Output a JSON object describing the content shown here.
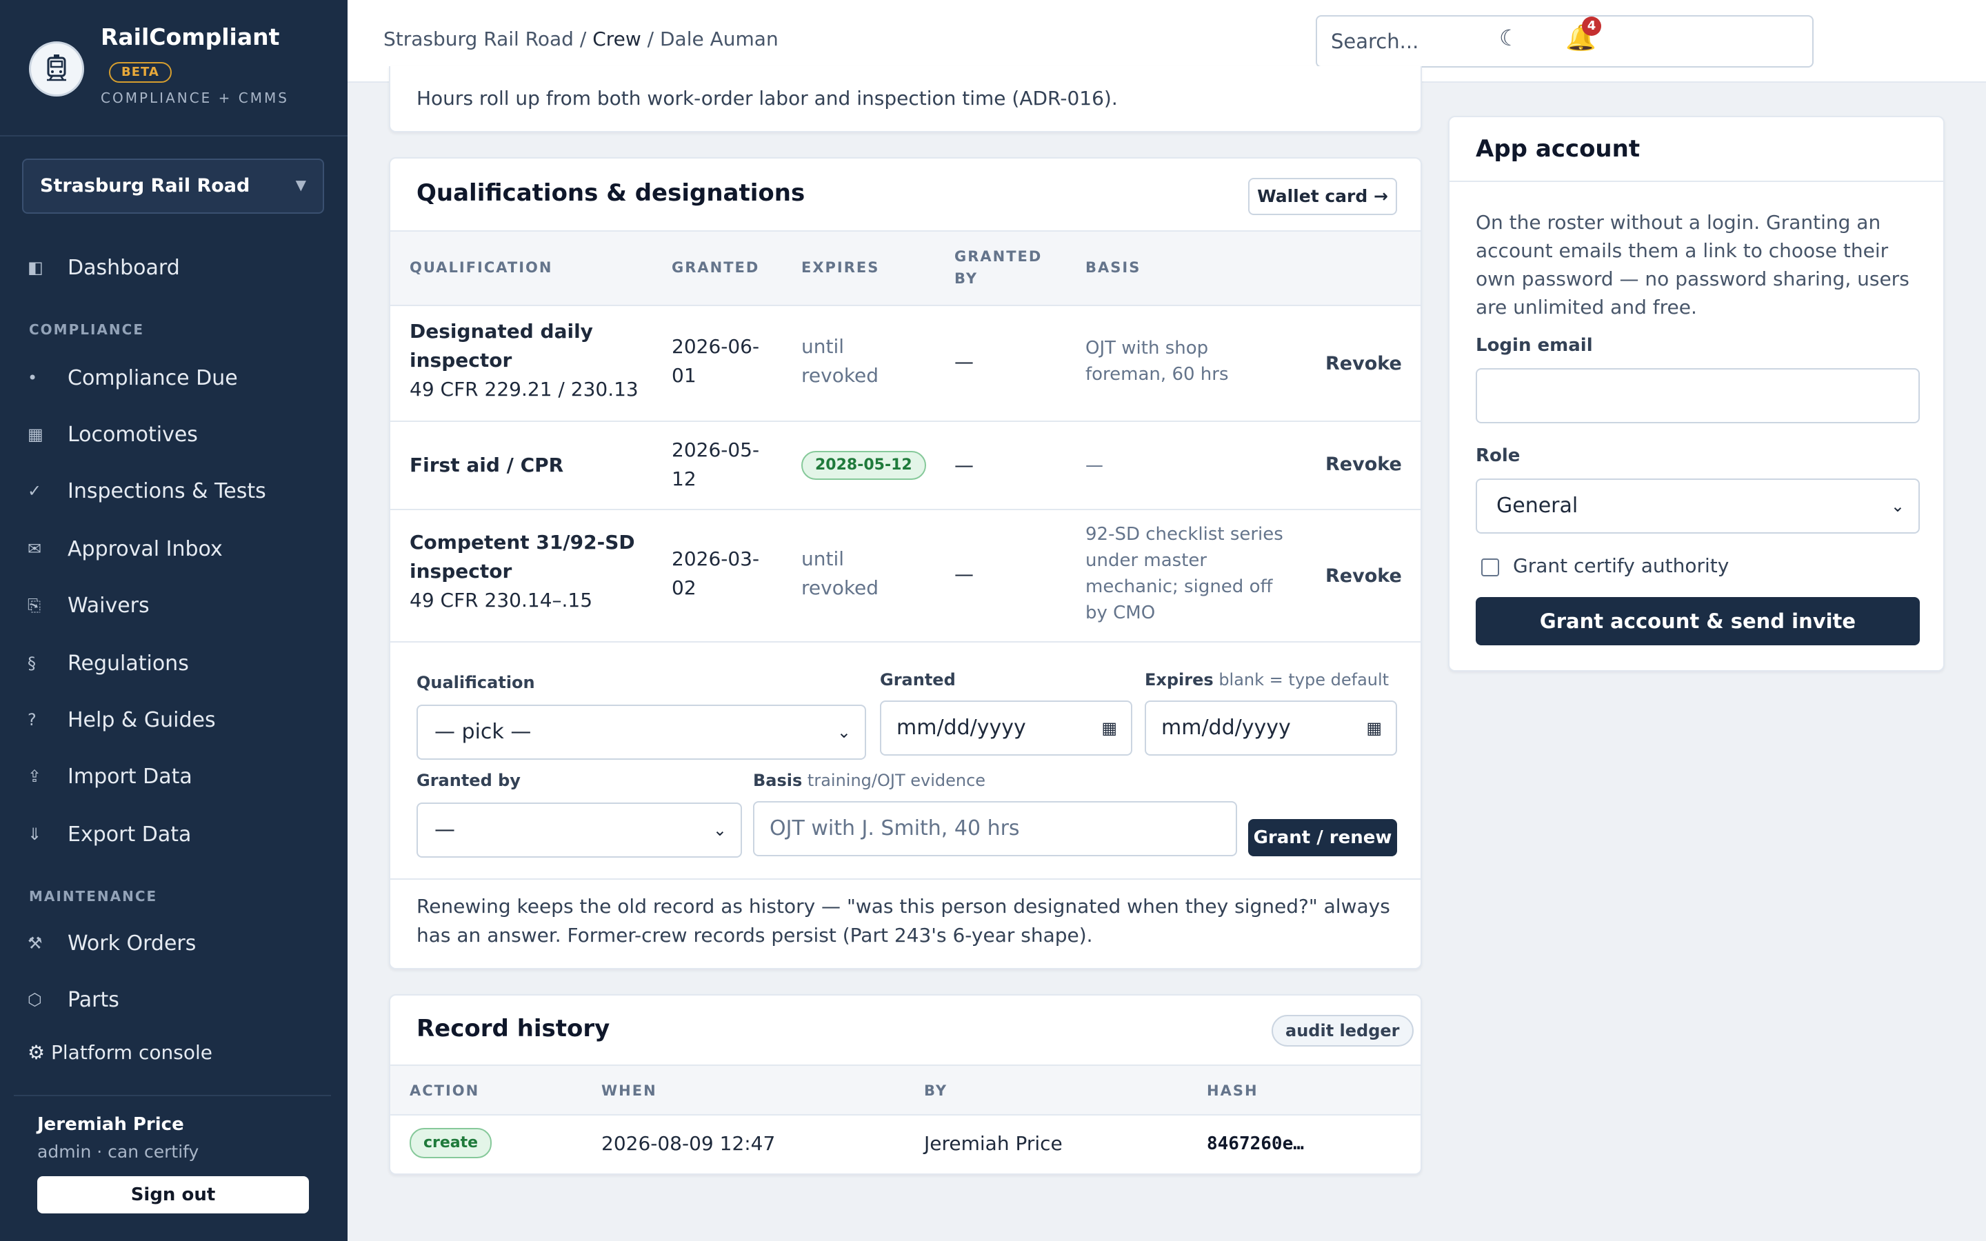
{
  "brand": {
    "name": "RailCompliant",
    "badge": "BETA",
    "subtitle": "COMPLIANCE + CMMS"
  },
  "org": {
    "selected": "Strasburg Rail Road"
  },
  "nav": {
    "dashboard": {
      "icon": "dashboard-icon",
      "label": "Dashboard"
    },
    "compliance_section": "COMPLIANCE",
    "compliance_items": [
      {
        "icon": "dot-icon",
        "label": "Compliance Due"
      },
      {
        "icon": "grid-icon",
        "label": "Locomotives"
      },
      {
        "icon": "check-icon",
        "label": "Inspections & Tests"
      },
      {
        "icon": "mail-icon",
        "label": "Approval Inbox"
      },
      {
        "icon": "waiver-icon",
        "label": "Waivers"
      },
      {
        "icon": "section-icon",
        "label": "Regulations"
      },
      {
        "icon": "help-icon",
        "label": "Help & Guides"
      },
      {
        "icon": "import-icon",
        "label": "Import Data"
      },
      {
        "icon": "export-icon",
        "label": "Export Data"
      }
    ],
    "maintenance_section": "MAINTENANCE",
    "maintenance_items": [
      {
        "icon": "wrench-icon",
        "label": "Work Orders"
      },
      {
        "icon": "hexagon-icon",
        "label": "Parts"
      }
    ],
    "platform_console": "⚙ Platform console"
  },
  "user": {
    "name": "Jeremiah Price",
    "role": "admin · can certify",
    "signout": "Sign out"
  },
  "topbar": {
    "breadcrumb": {
      "org": "Strasburg Rail Road",
      "sep1": " / ",
      "section": "Crew",
      "sep2": " / ",
      "person": "Dale Auman"
    },
    "search_placeholder": "Search...",
    "notifications": "4"
  },
  "hours_note": "Hours roll up from both work-order labor and inspection time (ADR-016).",
  "qualifications": {
    "title": "Qualifications & designations",
    "wallet_button": "Wallet card →",
    "columns": {
      "qualification": "QUALIFICATION",
      "granted": "GRANTED",
      "expires": "EXPIRES",
      "granted_by_1": "GRANTED",
      "granted_by_2": "BY",
      "basis": "BASIS"
    },
    "rows": [
      {
        "name_1": "Designated daily",
        "name_2": "inspector",
        "reg": "49 CFR 229.21 / 230.13",
        "granted_1": "2026-06-",
        "granted_2": "01",
        "expires_1": "until",
        "expires_2": "revoked",
        "granted_by": "—",
        "basis_1": "OJT with shop",
        "basis_2": "foreman, 60 hrs",
        "action": "Revoke"
      },
      {
        "name_1": "First aid / CPR",
        "granted_1": "2026-05-",
        "granted_2": "12",
        "expires_badge": "2028-05-12",
        "granted_by": "—",
        "basis_1": "—",
        "action": "Revoke"
      },
      {
        "name_1": "Competent 31/92-SD",
        "name_2": "inspector",
        "reg": "49 CFR 230.14–.15",
        "granted_1": "2026-03-",
        "granted_2": "02",
        "expires_1": "until",
        "expires_2": "revoked",
        "granted_by": "—",
        "basis_1": "92-SD checklist series",
        "basis_2": "under master",
        "basis_3": "mechanic; signed off",
        "basis_4": "by CMO",
        "action": "Revoke"
      }
    ],
    "form": {
      "qualification_label": "Qualification",
      "qualification_value": "— pick —",
      "granted_label": "Granted",
      "granted_placeholder": "mm/dd/yyyy",
      "expires_label": "Expires",
      "expires_hint": " blank = type default",
      "expires_placeholder": "mm/dd/yyyy",
      "granted_by_label": "Granted by",
      "granted_by_value": "—",
      "basis_label": "Basis",
      "basis_hint": " training/OJT evidence",
      "basis_placeholder": "OJT with J. Smith, 40 hrs",
      "submit": "Grant / renew"
    },
    "note": "Renewing keeps the old record as history — \"was this person designated when they signed?\" always has an answer. Former-crew records persist (Part 243's 6-year shape)."
  },
  "history": {
    "title": "Record history",
    "tag": "audit ledger",
    "columns": {
      "action": "ACTION",
      "when": "WHEN",
      "by": "BY",
      "hash": "HASH"
    },
    "rows": [
      {
        "action": "create",
        "when": "2026-08-09 12:47",
        "by": "Jeremiah Price",
        "hash": "8467260e…"
      }
    ]
  },
  "account": {
    "title": "App account",
    "description": "On the roster without a login. Granting an account emails them a link to choose their own password — no password sharing, users are unlimited and free.",
    "email_label": "Login email",
    "email_value": "",
    "role_label": "Role",
    "role_value": "General",
    "certify_label": "Grant certify authority",
    "submit": "Grant account & send invite"
  },
  "colors": {
    "sidebar_bg": "#1b2d45",
    "primary": "#1b2d45",
    "beta": "#e8a93a",
    "success_bg": "#e3f5e8",
    "success_text": "#1f7a3b",
    "notification": "#c53030"
  }
}
